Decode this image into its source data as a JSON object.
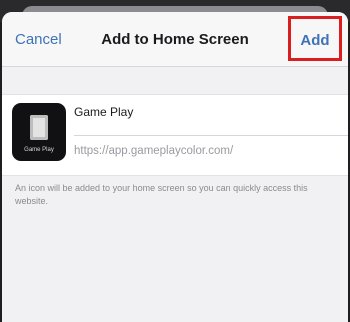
{
  "navbar": {
    "cancel_label": "Cancel",
    "title": "Add to Home Screen",
    "add_label": "Add",
    "highlight_color": "#d81e1e",
    "accent_color": "#3f73b5"
  },
  "shortcut": {
    "icon": "app-icon-placeholder",
    "icon_caption": "Game Play",
    "name_value": "Game Play",
    "url": "https://app.gameplaycolor.com/"
  },
  "footnote": "An icon will be added to your home screen so you can quickly access this website."
}
